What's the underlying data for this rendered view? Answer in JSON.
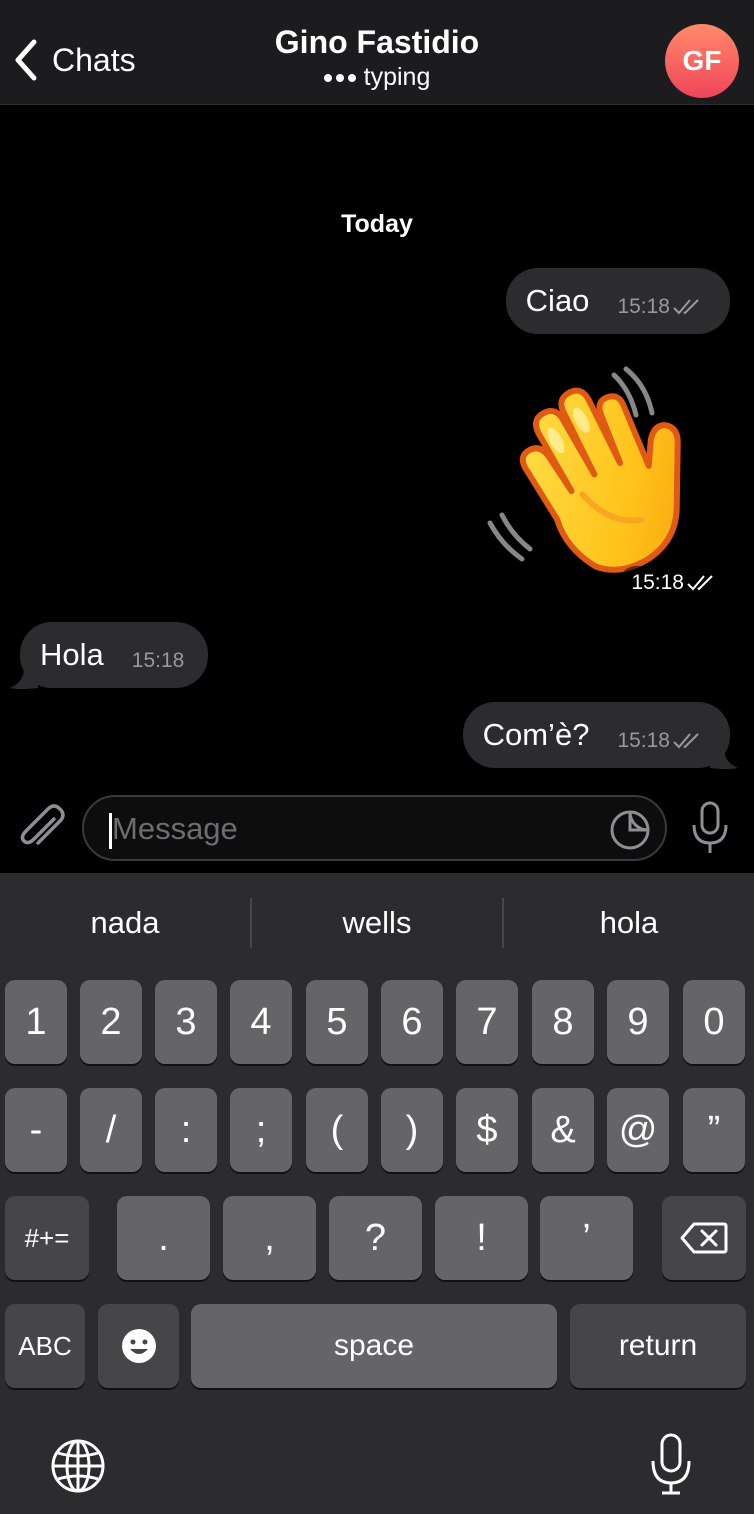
{
  "header": {
    "back_label": "Chats",
    "contact_name": "Gino Fastidio",
    "status": "typing",
    "avatar_initials": "GF"
  },
  "chat": {
    "date_separator": "Today",
    "messages": [
      {
        "direction": "outgoing",
        "text": "Ciao",
        "time": "15:18",
        "read": true
      },
      {
        "direction": "outgoing",
        "sticker": "waving-hand",
        "time": "15:18",
        "read": true
      },
      {
        "direction": "incoming",
        "text": "Hola",
        "time": "15:18"
      },
      {
        "direction": "outgoing",
        "text": "Com’è?",
        "time": "15:18",
        "read": true
      }
    ]
  },
  "input": {
    "placeholder": "Message"
  },
  "keyboard": {
    "suggestions": [
      "nada",
      "wells",
      "hola"
    ],
    "row1": [
      "1",
      "2",
      "3",
      "4",
      "5",
      "6",
      "7",
      "8",
      "9",
      "0"
    ],
    "row2": [
      "-",
      "/",
      ":",
      ";",
      "(",
      ")",
      "$",
      "&",
      "@",
      "”"
    ],
    "row3_mode": "#+=",
    "row3": [
      ".",
      ",",
      "?",
      "!",
      "’"
    ],
    "abc": "ABC",
    "space": "space",
    "return": "return"
  },
  "colors": {
    "background": "#000000",
    "bubble": "#2c2c2e",
    "keyboard": "#2c2c2e",
    "key": "#656567",
    "avatar_gradient_top": "#ff8a6a",
    "avatar_gradient_bottom": "#f0445a"
  }
}
